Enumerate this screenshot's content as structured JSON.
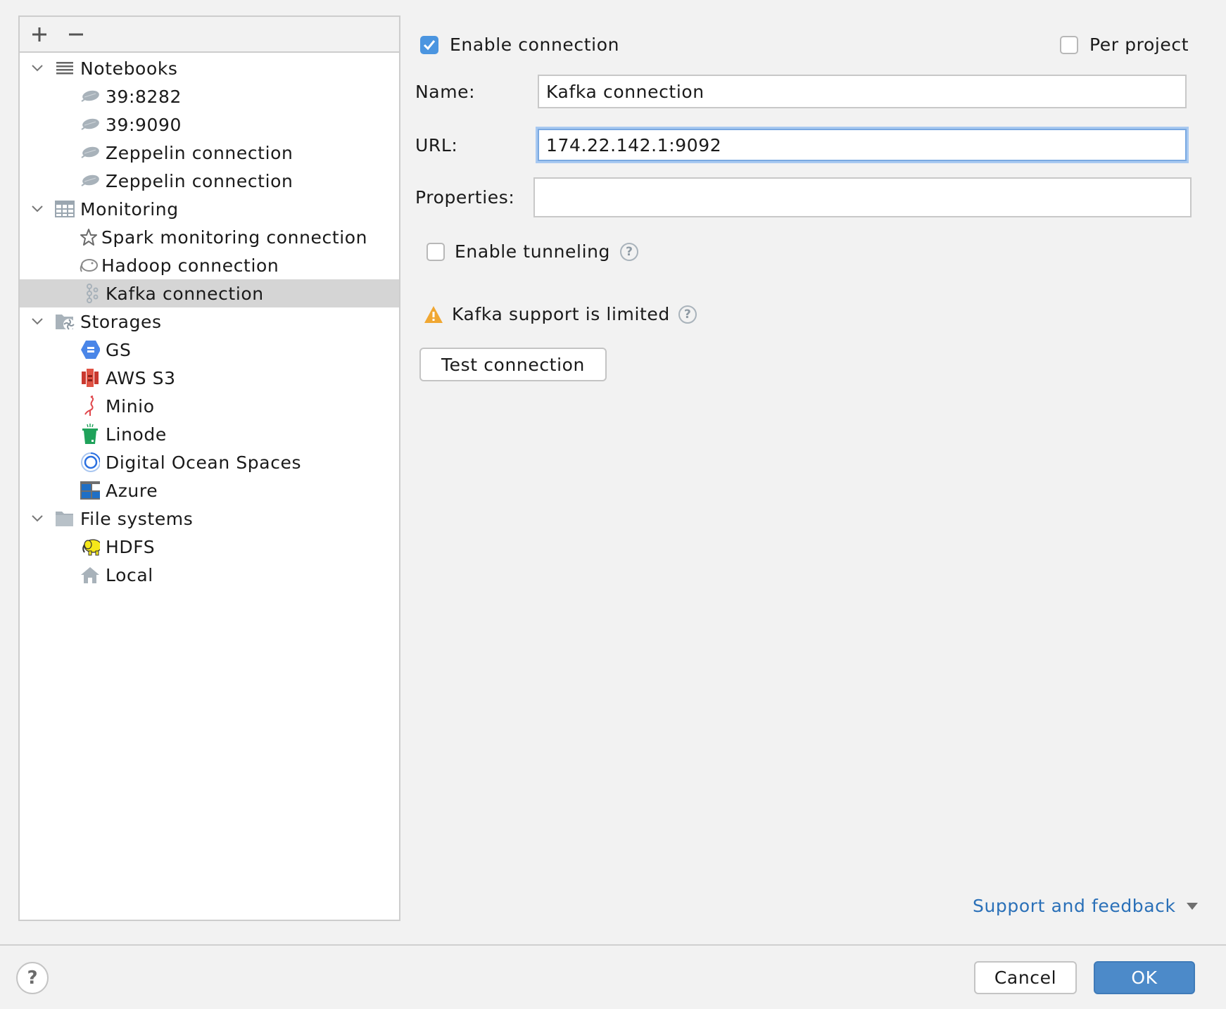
{
  "tree_toolbar": {
    "add_label": "+",
    "remove_label": "−"
  },
  "tree": {
    "groups": [
      {
        "label": "Notebooks",
        "icon": "list-icon",
        "expanded": true,
        "items": [
          {
            "label": "39:8282",
            "icon": "zeppelin-icon"
          },
          {
            "label": "39:9090",
            "icon": "zeppelin-icon"
          },
          {
            "label": "Zeppelin connection",
            "icon": "zeppelin-icon"
          },
          {
            "label": "Zeppelin connection",
            "icon": "zeppelin-icon"
          }
        ]
      },
      {
        "label": "Monitoring",
        "icon": "table-icon",
        "expanded": true,
        "items": [
          {
            "label": "Spark monitoring connection",
            "icon": "spark-star-icon"
          },
          {
            "label": "Hadoop connection",
            "icon": "hadoop-elephant-icon"
          },
          {
            "label": "Kafka connection",
            "icon": "kafka-icon",
            "selected": true
          }
        ]
      },
      {
        "label": "Storages",
        "icon": "storage-folder-icon",
        "expanded": true,
        "items": [
          {
            "label": "GS",
            "icon": "google-storage-icon"
          },
          {
            "label": "AWS S3",
            "icon": "aws-s3-icon"
          },
          {
            "label": "Minio",
            "icon": "minio-flamingo-icon"
          },
          {
            "label": "Linode",
            "icon": "linode-bucket-icon"
          },
          {
            "label": "Digital Ocean Spaces",
            "icon": "digital-ocean-icon"
          },
          {
            "label": "Azure",
            "icon": "azure-icon"
          }
        ]
      },
      {
        "label": "File systems",
        "icon": "folder-icon",
        "expanded": true,
        "items": [
          {
            "label": "HDFS",
            "icon": "hdfs-elephant-icon"
          },
          {
            "label": "Local",
            "icon": "home-icon"
          }
        ]
      }
    ]
  },
  "form": {
    "enable_connection": {
      "label": "Enable connection",
      "checked": true
    },
    "per_project": {
      "label": "Per project",
      "checked": false
    },
    "name": {
      "label": "Name:",
      "value": "Kafka connection"
    },
    "url": {
      "label": "URL:",
      "value": "174.22.142.1:9092"
    },
    "properties": {
      "label": "Properties:",
      "value": ""
    },
    "enable_tunneling": {
      "label": "Enable tunneling",
      "checked": false,
      "help": "?"
    },
    "warning": {
      "text": "Kafka support is limited",
      "help": "?"
    },
    "test_button": "Test connection"
  },
  "footer": {
    "support_link": "Support and feedback",
    "help_button": "?",
    "cancel": "Cancel",
    "ok": "OK"
  },
  "colors": {
    "accent": "#4c8ac9",
    "link": "#2a70b8",
    "warning": "#f0a732",
    "selection": "#d5d5d5"
  }
}
